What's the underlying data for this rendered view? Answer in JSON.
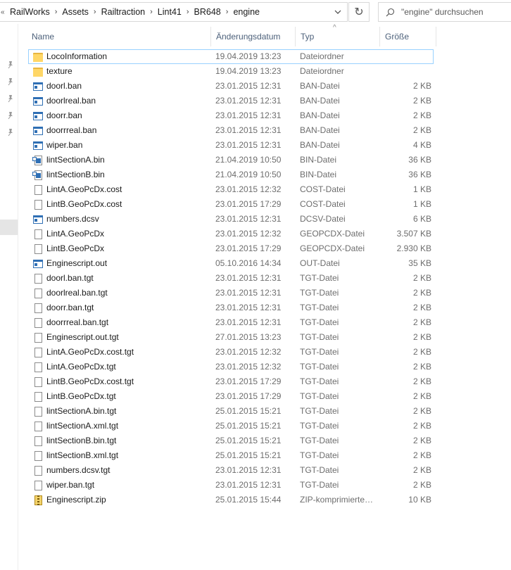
{
  "address": {
    "lead_glyph": "«",
    "crumbs": [
      {
        "label": "RailWorks"
      },
      {
        "label": "Assets"
      },
      {
        "label": "Railtraction"
      },
      {
        "label": "Lint41"
      },
      {
        "label": "BR648"
      },
      {
        "label": "engine"
      }
    ],
    "separator": "›",
    "dropdown_glyph": "⌄",
    "refresh_glyph": "↻"
  },
  "search": {
    "placeholder": "\"engine\" durchsuchen",
    "icon": "search-icon"
  },
  "columns": {
    "name": "Name",
    "date": "Änderungsdatum",
    "type": "Typ",
    "size": "Größe",
    "sort_indicator": "^"
  },
  "files": [
    {
      "name": "LocoInformation",
      "date": "19.04.2019 13:23",
      "type": "Dateiordner",
      "size": "",
      "icon": "folder-icon"
    },
    {
      "name": "texture",
      "date": "19.04.2019 13:23",
      "type": "Dateiordner",
      "size": "",
      "icon": "folder-icon"
    },
    {
      "name": "doorl.ban",
      "date": "23.01.2015 12:31",
      "type": "BAN-Datei",
      "size": "2 KB",
      "icon": "binary-file-icon"
    },
    {
      "name": "doorlreal.ban",
      "date": "23.01.2015 12:31",
      "type": "BAN-Datei",
      "size": "2 KB",
      "icon": "binary-file-icon"
    },
    {
      "name": "doorr.ban",
      "date": "23.01.2015 12:31",
      "type": "BAN-Datei",
      "size": "2 KB",
      "icon": "binary-file-icon"
    },
    {
      "name": "doorrreal.ban",
      "date": "23.01.2015 12:31",
      "type": "BAN-Datei",
      "size": "2 KB",
      "icon": "binary-file-icon"
    },
    {
      "name": "wiper.ban",
      "date": "23.01.2015 12:31",
      "type": "BAN-Datei",
      "size": "4 KB",
      "icon": "binary-file-icon"
    },
    {
      "name": "lintSectionA.bin",
      "date": "21.04.2019 10:50",
      "type": "BIN-Datei",
      "size": "36 KB",
      "icon": "bin-window-icon"
    },
    {
      "name": "lintSectionB.bin",
      "date": "21.04.2019 10:50",
      "type": "BIN-Datei",
      "size": "36 KB",
      "icon": "bin-window-icon"
    },
    {
      "name": "LintA.GeoPcDx.cost",
      "date": "23.01.2015 12:32",
      "type": "COST-Datei",
      "size": "1 KB",
      "icon": "file-icon"
    },
    {
      "name": "LintB.GeoPcDx.cost",
      "date": "23.01.2015 17:29",
      "type": "COST-Datei",
      "size": "1 KB",
      "icon": "file-icon"
    },
    {
      "name": "numbers.dcsv",
      "date": "23.01.2015 12:31",
      "type": "DCSV-Datei",
      "size": "6 KB",
      "icon": "binary-file-icon"
    },
    {
      "name": "LintA.GeoPcDx",
      "date": "23.01.2015 12:32",
      "type": "GEOPCDX-Datei",
      "size": "3.507 KB",
      "icon": "file-icon"
    },
    {
      "name": "LintB.GeoPcDx",
      "date": "23.01.2015 17:29",
      "type": "GEOPCDX-Datei",
      "size": "2.930 KB",
      "icon": "file-icon"
    },
    {
      "name": "Enginescript.out",
      "date": "05.10.2016 14:34",
      "type": "OUT-Datei",
      "size": "35 KB",
      "icon": "binary-file-icon"
    },
    {
      "name": "doorl.ban.tgt",
      "date": "23.01.2015 12:31",
      "type": "TGT-Datei",
      "size": "2 KB",
      "icon": "file-icon"
    },
    {
      "name": "doorlreal.ban.tgt",
      "date": "23.01.2015 12:31",
      "type": "TGT-Datei",
      "size": "2 KB",
      "icon": "file-icon"
    },
    {
      "name": "doorr.ban.tgt",
      "date": "23.01.2015 12:31",
      "type": "TGT-Datei",
      "size": "2 KB",
      "icon": "file-icon"
    },
    {
      "name": "doorrreal.ban.tgt",
      "date": "23.01.2015 12:31",
      "type": "TGT-Datei",
      "size": "2 KB",
      "icon": "file-icon"
    },
    {
      "name": "Enginescript.out.tgt",
      "date": "27.01.2015 13:23",
      "type": "TGT-Datei",
      "size": "2 KB",
      "icon": "file-icon"
    },
    {
      "name": "LintA.GeoPcDx.cost.tgt",
      "date": "23.01.2015 12:32",
      "type": "TGT-Datei",
      "size": "2 KB",
      "icon": "file-icon"
    },
    {
      "name": "LintA.GeoPcDx.tgt",
      "date": "23.01.2015 12:32",
      "type": "TGT-Datei",
      "size": "2 KB",
      "icon": "file-icon"
    },
    {
      "name": "LintB.GeoPcDx.cost.tgt",
      "date": "23.01.2015 17:29",
      "type": "TGT-Datei",
      "size": "2 KB",
      "icon": "file-icon"
    },
    {
      "name": "LintB.GeoPcDx.tgt",
      "date": "23.01.2015 17:29",
      "type": "TGT-Datei",
      "size": "2 KB",
      "icon": "file-icon"
    },
    {
      "name": "lintSectionA.bin.tgt",
      "date": "25.01.2015 15:21",
      "type": "TGT-Datei",
      "size": "2 KB",
      "icon": "file-icon"
    },
    {
      "name": "lintSectionA.xml.tgt",
      "date": "25.01.2015 15:21",
      "type": "TGT-Datei",
      "size": "2 KB",
      "icon": "file-icon"
    },
    {
      "name": "lintSectionB.bin.tgt",
      "date": "25.01.2015 15:21",
      "type": "TGT-Datei",
      "size": "2 KB",
      "icon": "file-icon"
    },
    {
      "name": "lintSectionB.xml.tgt",
      "date": "25.01.2015 15:21",
      "type": "TGT-Datei",
      "size": "2 KB",
      "icon": "file-icon"
    },
    {
      "name": "numbers.dcsv.tgt",
      "date": "23.01.2015 12:31",
      "type": "TGT-Datei",
      "size": "2 KB",
      "icon": "file-icon"
    },
    {
      "name": "wiper.ban.tgt",
      "date": "23.01.2015 12:31",
      "type": "TGT-Datei",
      "size": "2 KB",
      "icon": "file-icon"
    },
    {
      "name": "Enginescript.zip",
      "date": "25.01.2015 15:44",
      "type": "ZIP-komprimierte…",
      "size": "10 KB",
      "icon": "zip-icon"
    }
  ],
  "focused_index": 0,
  "colors": {
    "header_text": "#4c607a",
    "focus_border": "#99d1ff",
    "folder": "#ffd767",
    "meta_text": "#6d6d6d"
  }
}
